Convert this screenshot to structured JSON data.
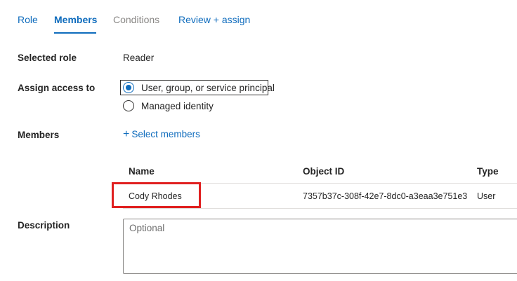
{
  "tabs": [
    {
      "label": "Role",
      "state": "link"
    },
    {
      "label": "Members",
      "state": "active"
    },
    {
      "label": "Conditions",
      "state": "disabled"
    },
    {
      "label": "Review + assign",
      "state": "link"
    }
  ],
  "selected_role": {
    "label": "Selected role",
    "value": "Reader"
  },
  "assign_access": {
    "label": "Assign access to",
    "options": [
      {
        "label": "User, group, or service principal",
        "checked": true
      },
      {
        "label": "Managed identity",
        "checked": false
      }
    ]
  },
  "members": {
    "label": "Members",
    "select_link": "Select members",
    "plus_icon": "+",
    "table": {
      "headers": [
        "Name",
        "Object ID",
        "Type"
      ],
      "rows": [
        {
          "name": "Cody Rhodes",
          "object_id": "7357b37c-308f-42e7-8dc0-a3eaa3e751e3",
          "type": "User"
        }
      ]
    }
  },
  "description": {
    "label": "Description",
    "placeholder": "Optional",
    "value": ""
  },
  "colors": {
    "accent": "#0f6cbd",
    "highlight": "#e02020",
    "disabled": "#8a8886"
  }
}
